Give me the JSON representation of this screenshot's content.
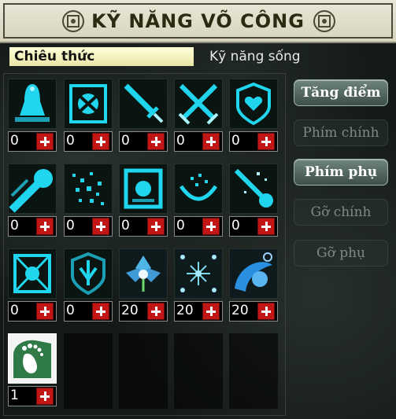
{
  "window": {
    "title": "KỸ NĂNG VÕ CÔNG"
  },
  "tabs": [
    {
      "label": "Chiêu thức",
      "active": true
    },
    {
      "label": "Kỹ năng sống",
      "active": false
    }
  ],
  "skills": [
    {
      "icon": "bell-skill-icon",
      "level": "0"
    },
    {
      "icon": "spinning-blade-skill-icon",
      "level": "0"
    },
    {
      "icon": "single-sword-skill-icon",
      "level": "0"
    },
    {
      "icon": "crossed-swords-skill-icon",
      "level": "0"
    },
    {
      "icon": "heart-shield-skill-icon",
      "level": "0"
    },
    {
      "icon": "dash-orb-skill-icon",
      "level": "0"
    },
    {
      "icon": "particle-burst-skill-icon",
      "level": "0"
    },
    {
      "icon": "spirit-block-skill-icon",
      "level": "0"
    },
    {
      "icon": "energy-bowl-skill-icon",
      "level": "0"
    },
    {
      "icon": "sparkle-strike-skill-icon",
      "level": "0"
    },
    {
      "icon": "mandala-skill-icon",
      "level": "0"
    },
    {
      "icon": "trident-shield-skill-icon",
      "level": "0"
    },
    {
      "icon": "lotus-skill-icon",
      "level": "20"
    },
    {
      "icon": "star-array-skill-icon",
      "level": "20"
    },
    {
      "icon": "wave-orb-skill-icon",
      "level": "20"
    },
    {
      "icon": "footprint-skill-icon",
      "level": "1"
    }
  ],
  "side_buttons": [
    {
      "label": "Tăng điểm",
      "enabled": true
    },
    {
      "label": "Phím chính",
      "enabled": false
    },
    {
      "label": "Phím phụ",
      "enabled": true
    },
    {
      "label": "Gỡ chính",
      "enabled": false
    },
    {
      "label": "Gỡ phụ",
      "enabled": false
    }
  ],
  "colors": {
    "accent_cyan": "#1fd6ee",
    "plus_red": "#c21616",
    "title_bg": "#e0dfca",
    "tab_active_bg": "#f4f2c0"
  }
}
